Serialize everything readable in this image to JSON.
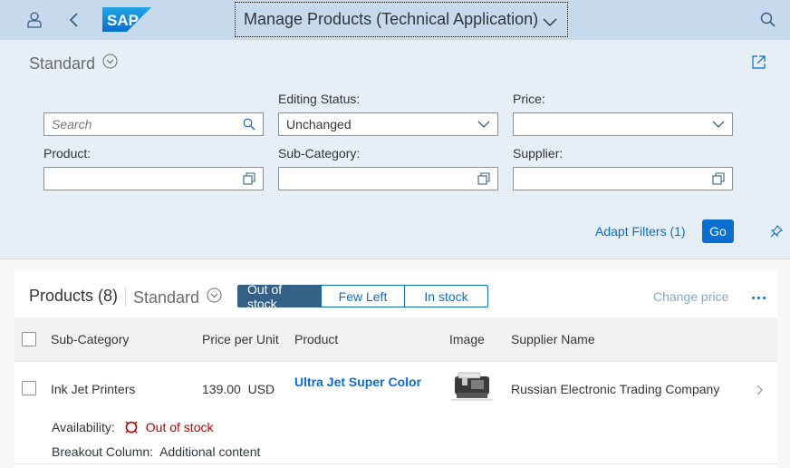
{
  "shell": {
    "title": "Manage Products (Technical Application)",
    "logo_text": "SAP",
    "icons": [
      "user-icon",
      "back-icon",
      "search-icon"
    ]
  },
  "filterbar": {
    "variant": "Standard",
    "filters": [
      {
        "label": "",
        "placeholder": "Search",
        "value": "",
        "icon": "search-icon"
      },
      {
        "label": "Editing Status:",
        "value": "Unchanged",
        "icon": "chevron-down-icon"
      },
      {
        "label": "Price:",
        "value": "",
        "icon": "chevron-down-icon"
      },
      {
        "label": "Product:",
        "value": "",
        "icon": "value-help-icon"
      },
      {
        "label": "Sub-Category:",
        "value": "",
        "icon": "value-help-icon"
      },
      {
        "label": "Supplier:",
        "value": "",
        "icon": "value-help-icon"
      }
    ],
    "adapt_filters": "Adapt Filters (1)",
    "go": "Go"
  },
  "table": {
    "title": "Products (8)",
    "variant": "Standard",
    "segments": [
      "Out of stock",
      "Few Left",
      "In stock"
    ],
    "selected_segment": "Out of stock",
    "change_price": "Change price",
    "columns": [
      "Sub-Category",
      "Price per Unit",
      "Product",
      "Image",
      "Supplier Name"
    ],
    "rows": [
      {
        "sub_category": "Ink Jet Printers",
        "price": "139.00",
        "currency": "USD",
        "product": "Ultra Jet Super Color",
        "supplier": "Russian Electronic Trading Company",
        "availability_label": "Availability:",
        "availability_value": "Out of stock",
        "breakout_label": "Breakout Column:",
        "breakout_value": "Additional content"
      }
    ]
  },
  "colors": {
    "shell_bg": "#c7d9ec",
    "filterbar_bg": "#e6eef6",
    "accent": "#0a6ed1",
    "selected_segment": "#346187",
    "error": "#bb0000"
  }
}
